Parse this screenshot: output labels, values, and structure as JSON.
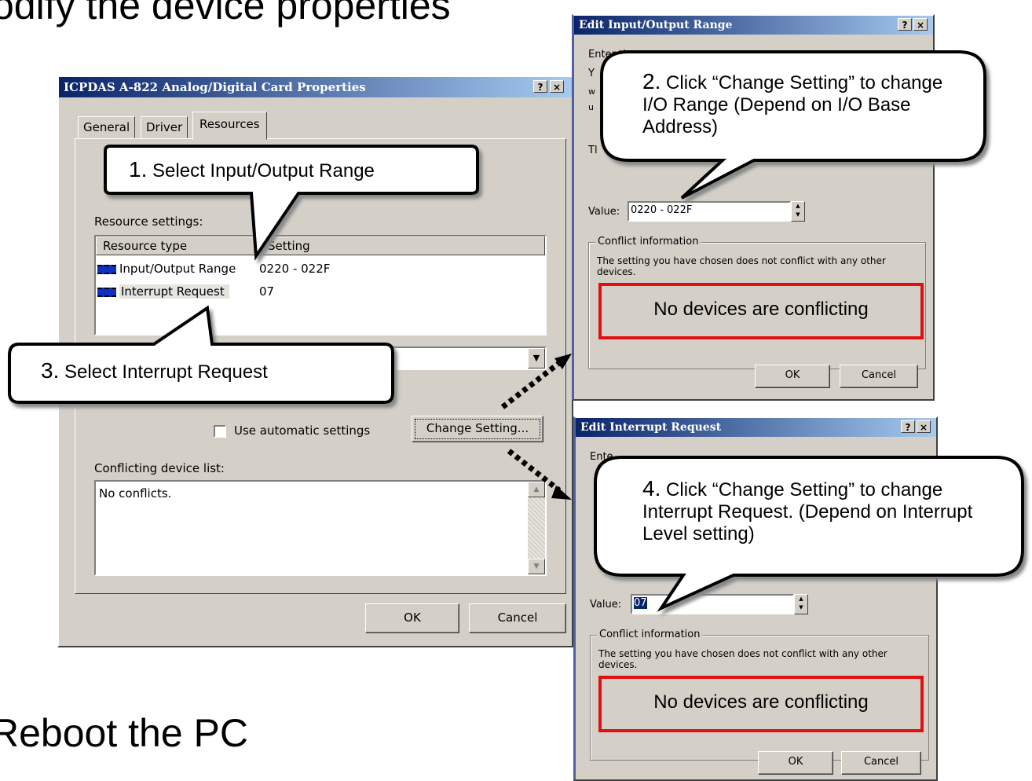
{
  "slide": {
    "top_text": "odify the device properties",
    "bottom_text": "Reboot the PC"
  },
  "main_dialog": {
    "title": "ICPDAS A-822 Analog/Digital Card Properties",
    "help_btn": "?",
    "close_btn": "×",
    "tabs": [
      "General",
      "Driver",
      "Resources"
    ],
    "resource_settings_label": "Resource settings:",
    "col_resource_type": "Resource type",
    "col_setting": "Setting",
    "rows": [
      {
        "type": "Input/Output Range",
        "setting": "0220 - 022F"
      },
      {
        "type": "Interrupt Request",
        "setting": "07"
      }
    ],
    "auto_settings_label": "Use automatic settings",
    "change_setting_btn": "Change Setting...",
    "conflicting_label": "Conflicting device list:",
    "conflicts_text": "No conflicts.",
    "ok_btn": "OK",
    "cancel_btn": "Cancel"
  },
  "io_dialog": {
    "title": "Edit Input/Output Range",
    "help_btn": "?",
    "close_btn": "×",
    "line1": "Enter th",
    "line2_a": "Y",
    "line2_b": "w",
    "line2_c": "u",
    "line3": "Tl",
    "value_label": "Value:",
    "value": "0220 - 022F",
    "conflict_group": "Conflict information",
    "conflict_text": "The setting you have chosen does not conflict with any other devices.",
    "ok_btn": "OK",
    "cancel_btn": "Cancel"
  },
  "irq_dialog": {
    "title": "Edit Interrupt Request",
    "help_btn": "?",
    "close_btn": "×",
    "line1": "Ente",
    "value_label": "Value:",
    "value": "07",
    "conflict_group": "Conflict information",
    "conflict_text": "The setting you have chosen does not conflict with any other devices.",
    "ok_btn": "OK",
    "cancel_btn": "Cancel"
  },
  "callouts": {
    "c1_num": "1.",
    "c1_text": "Select Input/Output Range",
    "c2_num": "2.",
    "c2_text": "Click “Change Setting” to change I/O Range (Depend on I/O Base Address)",
    "c3_num": "3.",
    "c3_text": "Select Interrupt Request",
    "c4_num": "4.",
    "c4_text": "Click “Change Setting” to change Interrupt Request. (Depend on Interrupt Level setting)",
    "no_conflict_1": "No devices are conflicting",
    "no_conflict_2": "No devices are conflicting"
  },
  "colors": {
    "title_bar": "#0a246a",
    "dialog_bg": "#d4d0c8",
    "highlight_box": "#e01010",
    "arrow": "#000000"
  },
  "icons": [
    "help-icon",
    "close-icon",
    "chip-icon",
    "spin-up-icon",
    "spin-down-icon",
    "dropdown-arrow-icon",
    "scroll-up-icon",
    "scroll-down-icon"
  ]
}
